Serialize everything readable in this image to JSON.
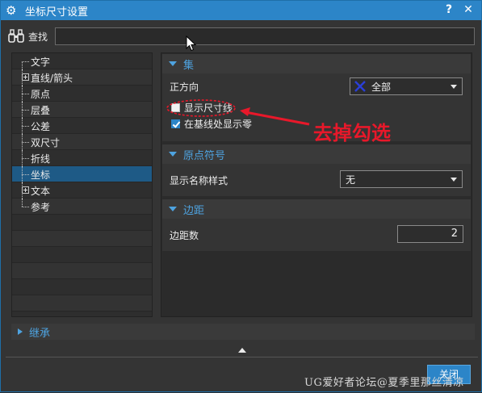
{
  "window": {
    "title": "坐标尺寸设置",
    "help_label": "?",
    "close_label": "✕"
  },
  "find": {
    "label": "查找",
    "value": "",
    "placeholder": ""
  },
  "tree": {
    "items": [
      {
        "label": "文字",
        "expandable": false,
        "selected": false
      },
      {
        "label": "直线/箭头",
        "expandable": true,
        "selected": false
      },
      {
        "label": "原点",
        "expandable": false,
        "selected": false
      },
      {
        "label": "层叠",
        "expandable": false,
        "selected": false
      },
      {
        "label": "公差",
        "expandable": false,
        "selected": false
      },
      {
        "label": "双尺寸",
        "expandable": false,
        "selected": false
      },
      {
        "label": "折线",
        "expandable": false,
        "selected": false
      },
      {
        "label": "坐标",
        "expandable": false,
        "selected": true
      },
      {
        "label": "文本",
        "expandable": true,
        "selected": false
      },
      {
        "label": "参考",
        "expandable": false,
        "selected": false
      }
    ]
  },
  "sections": {
    "set": {
      "title": "集",
      "direction_label": "正方向",
      "direction_value": "全部",
      "show_dim_line_label": "显示尺寸线",
      "show_dim_line_checked": false,
      "show_zero_label": "在基线处显示零",
      "show_zero_checked": true
    },
    "origin": {
      "title": "原点符号",
      "name_style_label": "显示名称样式",
      "name_style_value": "无"
    },
    "margin": {
      "title": "边距",
      "margin_label": "边距数",
      "margin_value": "2"
    }
  },
  "inherit": {
    "label": "继承"
  },
  "footer": {
    "close_label": "关闭",
    "watermark": "UG爱好者论坛@夏季里那丝清凉"
  },
  "annotation": {
    "text": "去掉勾选",
    "color": "#e8182a"
  },
  "colors": {
    "accent": "#2c85c8",
    "section_title": "#4ea3e0",
    "selected_row": "#1e5a86"
  }
}
